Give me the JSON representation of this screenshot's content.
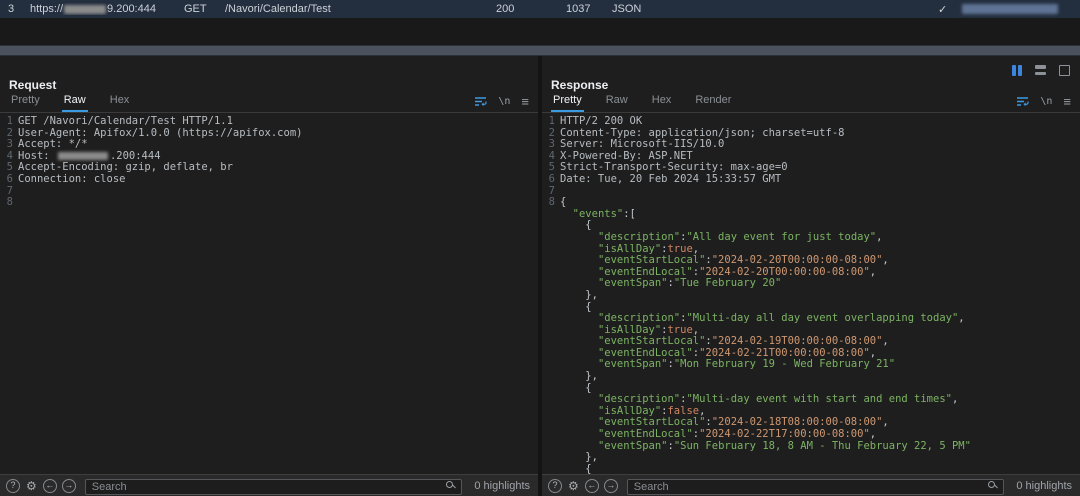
{
  "accent": "#3a9ae2",
  "icons": {
    "help": "?",
    "gear": "⚙",
    "left_arrow": "←",
    "right_arrow": "→",
    "newline": "\\n",
    "menu": "≡"
  },
  "session_row": {
    "id": "3",
    "url_prefix": "https://",
    "url_suffix": "9.200:444",
    "method": "GET",
    "path": "/Navori/Calendar/Test",
    "status": "200",
    "body_size": "1037",
    "type": "JSON",
    "check": "✓"
  },
  "request": {
    "title": "Request",
    "tabs": [
      {
        "label": "Pretty",
        "active": false
      },
      {
        "label": "Raw",
        "active": true
      },
      {
        "label": "Hex",
        "active": false
      }
    ],
    "lines": [
      {
        "n": "1",
        "seg": [
          {
            "t": "GET /Navori/Calendar/Test HTTP/1.1",
            "c": "plain"
          }
        ]
      },
      {
        "n": "2",
        "seg": [
          {
            "t": "User-Agent: Apifox/1.0.0 (https://apifox.com)",
            "c": "plain"
          }
        ]
      },
      {
        "n": "3",
        "seg": [
          {
            "t": "Accept: */*",
            "c": "plain"
          }
        ]
      },
      {
        "n": "4",
        "seg": [
          {
            "t": "Host: ",
            "c": "plain"
          },
          {
            "redact": 50
          },
          {
            "t": ".200:444",
            "c": "plain"
          }
        ]
      },
      {
        "n": "5",
        "seg": [
          {
            "t": "Accept-Encoding: gzip, deflate, br",
            "c": "plain"
          }
        ]
      },
      {
        "n": "6",
        "seg": [
          {
            "t": "Connection: close",
            "c": "plain"
          }
        ]
      },
      {
        "n": "7",
        "seg": []
      },
      {
        "n": "8",
        "seg": []
      }
    ],
    "footer": {
      "search_placeholder": "Search",
      "highlights": "0 highlights"
    }
  },
  "response": {
    "title": "Response",
    "tabs": [
      {
        "label": "Pretty",
        "active": true
      },
      {
        "label": "Raw",
        "active": false
      },
      {
        "label": "Hex",
        "active": false
      },
      {
        "label": "Render",
        "active": false
      }
    ],
    "lines": [
      {
        "n": "1",
        "seg": [
          {
            "t": "HTTP/2 200 OK",
            "c": "plain"
          }
        ]
      },
      {
        "n": "2",
        "seg": [
          {
            "t": "Content-Type: application/json; charset=utf-8",
            "c": "plain"
          }
        ]
      },
      {
        "n": "3",
        "seg": [
          {
            "t": "Server: Microsoft-IIS/10.0",
            "c": "plain"
          }
        ]
      },
      {
        "n": "4",
        "seg": [
          {
            "t": "X-Powered-By: ASP.NET",
            "c": "plain"
          }
        ]
      },
      {
        "n": "5",
        "seg": [
          {
            "t": "Strict-Transport-Security: max-age=0",
            "c": "plain"
          }
        ]
      },
      {
        "n": "6",
        "seg": [
          {
            "t": "Date: Tue, 20 Feb 2024 15:33:57 GMT",
            "c": "plain"
          }
        ]
      },
      {
        "n": "7",
        "seg": []
      },
      {
        "n": "8",
        "seg": [
          {
            "t": "{",
            "c": "punc"
          }
        ]
      },
      {
        "n": "",
        "seg": [
          {
            "t": "  ",
            "c": "plain"
          },
          {
            "t": "\"events\"",
            "c": "key"
          },
          {
            "t": ":[",
            "c": "punc"
          }
        ]
      },
      {
        "n": "",
        "seg": [
          {
            "t": "    {",
            "c": "punc"
          }
        ]
      },
      {
        "n": "",
        "seg": [
          {
            "t": "      ",
            "c": "plain"
          },
          {
            "t": "\"description\"",
            "c": "key"
          },
          {
            "t": ":",
            "c": "punc"
          },
          {
            "t": "\"All day event for just today\"",
            "c": "str"
          },
          {
            "t": ",",
            "c": "punc"
          }
        ]
      },
      {
        "n": "",
        "seg": [
          {
            "t": "      ",
            "c": "plain"
          },
          {
            "t": "\"isAllDay\"",
            "c": "key"
          },
          {
            "t": ":",
            "c": "punc"
          },
          {
            "t": "true",
            "c": "bool"
          },
          {
            "t": ",",
            "c": "punc"
          }
        ]
      },
      {
        "n": "",
        "seg": [
          {
            "t": "      ",
            "c": "plain"
          },
          {
            "t": "\"eventStartLocal\"",
            "c": "key"
          },
          {
            "t": ":",
            "c": "punc"
          },
          {
            "t": "\"2024-02-20T00:00:00-08:00\"",
            "c": "date"
          },
          {
            "t": ",",
            "c": "punc"
          }
        ]
      },
      {
        "n": "",
        "seg": [
          {
            "t": "      ",
            "c": "plain"
          },
          {
            "t": "\"eventEndLocal\"",
            "c": "key"
          },
          {
            "t": ":",
            "c": "punc"
          },
          {
            "t": "\"2024-02-20T00:00:00-08:00\"",
            "c": "date"
          },
          {
            "t": ",",
            "c": "punc"
          }
        ]
      },
      {
        "n": "",
        "seg": [
          {
            "t": "      ",
            "c": "plain"
          },
          {
            "t": "\"eventSpan\"",
            "c": "key"
          },
          {
            "t": ":",
            "c": "punc"
          },
          {
            "t": "\"Tue February 20\"",
            "c": "str"
          }
        ]
      },
      {
        "n": "",
        "seg": [
          {
            "t": "    },",
            "c": "punc"
          }
        ]
      },
      {
        "n": "",
        "seg": [
          {
            "t": "    {",
            "c": "punc"
          }
        ]
      },
      {
        "n": "",
        "seg": [
          {
            "t": "      ",
            "c": "plain"
          },
          {
            "t": "\"description\"",
            "c": "key"
          },
          {
            "t": ":",
            "c": "punc"
          },
          {
            "t": "\"Multi-day all day event overlapping today\"",
            "c": "str"
          },
          {
            "t": ",",
            "c": "punc"
          }
        ]
      },
      {
        "n": "",
        "seg": [
          {
            "t": "      ",
            "c": "plain"
          },
          {
            "t": "\"isAllDay\"",
            "c": "key"
          },
          {
            "t": ":",
            "c": "punc"
          },
          {
            "t": "true",
            "c": "bool"
          },
          {
            "t": ",",
            "c": "punc"
          }
        ]
      },
      {
        "n": "",
        "seg": [
          {
            "t": "      ",
            "c": "plain"
          },
          {
            "t": "\"eventStartLocal\"",
            "c": "key"
          },
          {
            "t": ":",
            "c": "punc"
          },
          {
            "t": "\"2024-02-19T00:00:00-08:00\"",
            "c": "date"
          },
          {
            "t": ",",
            "c": "punc"
          }
        ]
      },
      {
        "n": "",
        "seg": [
          {
            "t": "      ",
            "c": "plain"
          },
          {
            "t": "\"eventEndLocal\"",
            "c": "key"
          },
          {
            "t": ":",
            "c": "punc"
          },
          {
            "t": "\"2024-02-21T00:00:00-08:00\"",
            "c": "date"
          },
          {
            "t": ",",
            "c": "punc"
          }
        ]
      },
      {
        "n": "",
        "seg": [
          {
            "t": "      ",
            "c": "plain"
          },
          {
            "t": "\"eventSpan\"",
            "c": "key"
          },
          {
            "t": ":",
            "c": "punc"
          },
          {
            "t": "\"Mon February 19 - Wed February 21\"",
            "c": "str"
          }
        ]
      },
      {
        "n": "",
        "seg": [
          {
            "t": "    },",
            "c": "punc"
          }
        ]
      },
      {
        "n": "",
        "seg": [
          {
            "t": "    {",
            "c": "punc"
          }
        ]
      },
      {
        "n": "",
        "seg": [
          {
            "t": "      ",
            "c": "plain"
          },
          {
            "t": "\"description\"",
            "c": "key"
          },
          {
            "t": ":",
            "c": "punc"
          },
          {
            "t": "\"Multi-day event with start and end times\"",
            "c": "str"
          },
          {
            "t": ",",
            "c": "punc"
          }
        ]
      },
      {
        "n": "",
        "seg": [
          {
            "t": "      ",
            "c": "plain"
          },
          {
            "t": "\"isAllDay\"",
            "c": "key"
          },
          {
            "t": ":",
            "c": "punc"
          },
          {
            "t": "false",
            "c": "bool"
          },
          {
            "t": ",",
            "c": "punc"
          }
        ]
      },
      {
        "n": "",
        "seg": [
          {
            "t": "      ",
            "c": "plain"
          },
          {
            "t": "\"eventStartLocal\"",
            "c": "key"
          },
          {
            "t": ":",
            "c": "punc"
          },
          {
            "t": "\"2024-02-18T08:00:00-08:00\"",
            "c": "date"
          },
          {
            "t": ",",
            "c": "punc"
          }
        ]
      },
      {
        "n": "",
        "seg": [
          {
            "t": "      ",
            "c": "plain"
          },
          {
            "t": "\"eventEndLocal\"",
            "c": "key"
          },
          {
            "t": ":",
            "c": "punc"
          },
          {
            "t": "\"2024-02-22T17:00:00-08:00\"",
            "c": "date"
          },
          {
            "t": ",",
            "c": "punc"
          }
        ]
      },
      {
        "n": "",
        "seg": [
          {
            "t": "      ",
            "c": "plain"
          },
          {
            "t": "\"eventSpan\"",
            "c": "key"
          },
          {
            "t": ":",
            "c": "punc"
          },
          {
            "t": "\"Sun February 18, 8 AM - Thu February 22, 5 PM\"",
            "c": "str"
          }
        ]
      },
      {
        "n": "",
        "seg": [
          {
            "t": "    },",
            "c": "punc"
          }
        ]
      },
      {
        "n": "",
        "seg": [
          {
            "t": "    {",
            "c": "punc"
          }
        ]
      }
    ],
    "footer": {
      "search_placeholder": "Search",
      "highlights": "0 highlights"
    }
  }
}
